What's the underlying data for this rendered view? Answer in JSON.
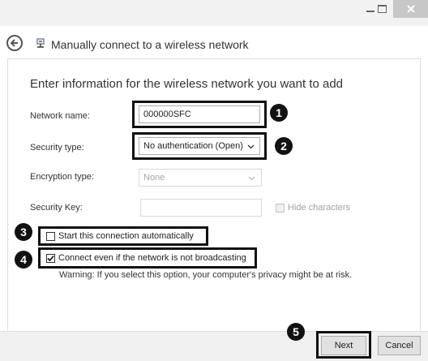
{
  "window": {
    "title": "Manually connect to a wireless network",
    "minimize_glyph": "—",
    "close_glyph": "✕"
  },
  "instruction": "Enter information for the wireless network you want to add",
  "form": {
    "network_name_label": "Network name:",
    "network_name_value": "000000SFC",
    "security_type_label": "Security type:",
    "security_type_value": "No authentication (Open)",
    "encryption_type_label": "Encryption type:",
    "encryption_type_value": "None",
    "security_key_label": "Security Key:",
    "security_key_value": "",
    "hide_characters_label": "Hide characters"
  },
  "options": {
    "start_auto_label": "Start this connection automatically",
    "start_auto_checked": false,
    "connect_broadcast_label": "Connect even if the network is not broadcasting",
    "connect_broadcast_checked": true,
    "warning": "Warning: If you select this option, your computer's privacy might be at risk."
  },
  "callouts": [
    "1",
    "2",
    "3",
    "4",
    "5"
  ],
  "buttons": {
    "next": "Next",
    "cancel": "Cancel"
  },
  "colors": {
    "callout": "#111111",
    "close_button": "#c7c7c7"
  },
  "icons": [
    "back-arrow-icon",
    "wireless-network-icon",
    "minimize-icon",
    "maximize-icon",
    "close-icon",
    "checkmark-icon",
    "chevron-down-icon"
  ]
}
